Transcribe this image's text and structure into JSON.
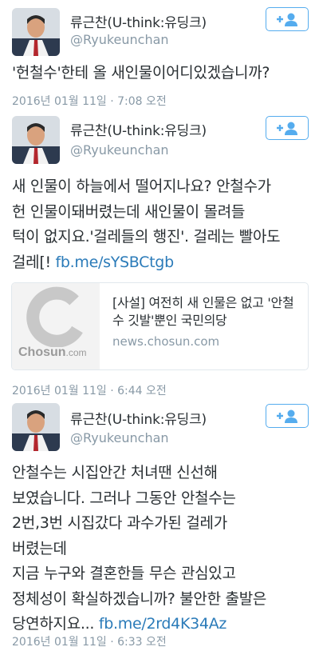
{
  "tweets": [
    {
      "name": "류근찬(U-think:유딩크)",
      "handle": "@Ryukeunchan",
      "lines": [
        "'헌철수'한테 올 새인물이어디있겠습니까?"
      ],
      "link": "",
      "meta": "2016년 01월 11일 · 7:08 오전",
      "avatar_icon": "user-avatar-photo",
      "follow_icon": "follow-add-user-icon"
    },
    {
      "name": "류근찬(U-think:유딩크)",
      "handle": "@Ryukeunchan",
      "lines": [
        "새 인물이 하늘에서 떨어지나요? 안철수가",
        "헌 인물이돼버렸는데 새인물이 몰려들",
        "턱이 없지요.'걸레들의 행진'. 걸레는 빨아도",
        "걸레[! "
      ],
      "link": "fb.me/sYSBCtgb",
      "card": {
        "title": "[사설] 여전히 새 인물은 없고 '안철수 깃발'뿐인 국민의당",
        "domain": "news.chosun.com",
        "thumb_label": "Chosun",
        "thumb_suffix": ".com",
        "thumb_icon": "chosun-logo"
      },
      "meta": "2016년 01월 11일 · 6:44 오전",
      "avatar_icon": "user-avatar-photo",
      "follow_icon": "follow-add-user-icon"
    },
    {
      "name": "류근찬(U-think:유딩크)",
      "handle": "@Ryukeunchan",
      "lines": [
        "안철수는 시집안간 처녀땐 신선해",
        "보였습니다. 그러나 그동안 안철수는",
        "2번,3번 시집갔다 과수가된 걸레가",
        "버렸는데",
        "지금 누구와 결혼한들 무슨 관심있고",
        "정체성이 확실하겠습니까?  불안한 출발은",
        "당연하지요... "
      ],
      "link": "fb.me/2rd4K34Az",
      "meta": "2016년 01월 11일 · 6:33 오전",
      "avatar_icon": "user-avatar-photo",
      "follow_icon": "follow-add-user-icon"
    }
  ],
  "colors": {
    "accent": "#55acee",
    "link": "#2b7bb9",
    "muted": "#8899a6",
    "text": "#292f33"
  }
}
